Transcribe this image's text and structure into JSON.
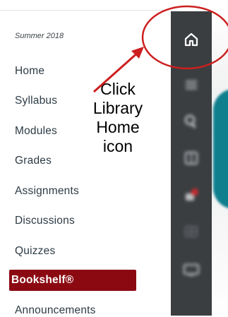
{
  "course": {
    "term": "Summer 2018"
  },
  "nav": {
    "items": [
      {
        "label": "Home"
      },
      {
        "label": "Syllabus"
      },
      {
        "label": "Modules"
      },
      {
        "label": "Grades"
      },
      {
        "label": "Assignments"
      },
      {
        "label": "Discussions"
      },
      {
        "label": "Quizzes"
      },
      {
        "label": "Bookshelf®",
        "active": true
      },
      {
        "label": "Announcements"
      }
    ]
  },
  "annotation": {
    "text": "Click\nLibrary\nHome\nicon",
    "color": "#cc1f1f"
  },
  "toolbar": {
    "buttons": [
      "home-icon",
      "list-icon",
      "search-icon",
      "book-icon",
      "notification-icon",
      "grid-icon",
      "monitor-icon"
    ],
    "background": "#3b3e41"
  },
  "colors": {
    "active_bg": "#8b0a12",
    "text": "#2d3b45"
  }
}
